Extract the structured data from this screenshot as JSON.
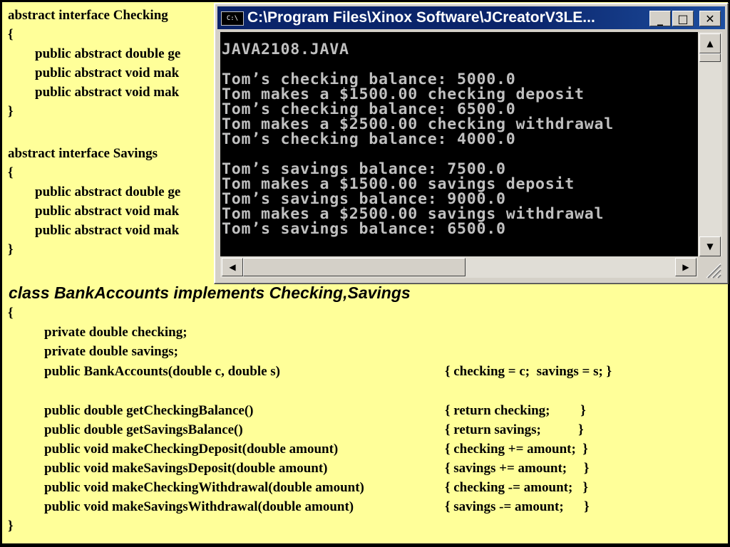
{
  "slide": {
    "code_top": [
      "abstract interface Checking",
      "{",
      "        public abstract double ge",
      "        public abstract void mak",
      "        public abstract void mak",
      "}",
      "",
      "abstract interface Savings",
      "{",
      "        public abstract double ge",
      "        public abstract void mak",
      "        public abstract void mak",
      "}"
    ],
    "class_heading": "class BankAccounts implements Checking,Savings",
    "class_open": "{",
    "fields": [
      "private double checking;",
      "private double savings;"
    ],
    "methods": [
      {
        "sig": "public BankAccounts(double c, double s)",
        "body": "{ checking = c;  savings = s; }"
      },
      {
        "sig": "",
        "body": ""
      },
      {
        "sig": "public double getCheckingBalance()",
        "body": "{ return checking;         }"
      },
      {
        "sig": "public double getSavingsBalance()",
        "body": "{ return savings;           }"
      },
      {
        "sig": "public void makeCheckingDeposit(double amount)",
        "body": "{ checking += amount;  }"
      },
      {
        "sig": "public void makeSavingsDeposit(double amount)",
        "body": "{ savings += amount;     }"
      },
      {
        "sig": "public void makeCheckingWithdrawal(double amount)",
        "body": "{ checking -= amount;   }"
      },
      {
        "sig": "public void makeSavingsWithdrawal(double amount)",
        "body": "{ savings -= amount;      }"
      }
    ],
    "class_close": "}"
  },
  "window": {
    "title": "C:\\Program Files\\Xinox Software\\JCreatorV3LE...",
    "sys_icon_text": "C:\\",
    "minimize": "_",
    "maximize": "□",
    "close": "✕",
    "console_output": "JAVA2108.JAVA\n\nTom’s checking balance: 5000.0\nTom makes a $1500.00 checking deposit\nTom’s checking balance: 6500.0\nTom makes a $2500.00 checking withdrawal\nTom’s checking balance: 4000.0\n\nTom’s savings balance: 7500.0\nTom makes a $1500.00 savings deposit\nTom’s savings balance: 9000.0\nTom makes a $2500.00 savings withdrawal\nTom’s savings balance: 6500.0",
    "scroll_up": "▲",
    "scroll_down": "▼",
    "scroll_left": "◀",
    "scroll_right": "▶"
  }
}
